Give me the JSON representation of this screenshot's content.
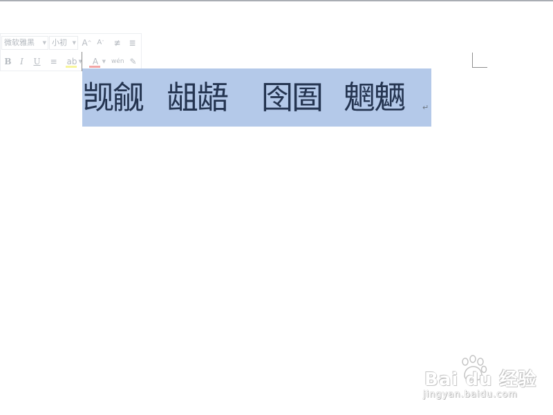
{
  "mini_toolbar": {
    "font_name": "微软雅黑",
    "font_size": "小初",
    "grow_font": "A",
    "shrink_font": "A",
    "indent_decrease": "≢",
    "indent_increase": "≣",
    "bold": "B",
    "italic": "I",
    "underline": "U",
    "center": "≡",
    "highlight": "ab",
    "font_color": "A",
    "phonetic": "wén",
    "format_painter": "✎",
    "highlight_color": "#f7f59a",
    "font_color_value": "#f2a6a6"
  },
  "document": {
    "groups": [
      "觊觎",
      "龃龉",
      "囹圄",
      "魍魉"
    ],
    "paragraph_mark": "↵",
    "selection_color": "#b4c9e9",
    "text_color": "#243450"
  },
  "watermark": {
    "brand": "Bai du 经验",
    "url": "jingyan.baidu.com"
  }
}
